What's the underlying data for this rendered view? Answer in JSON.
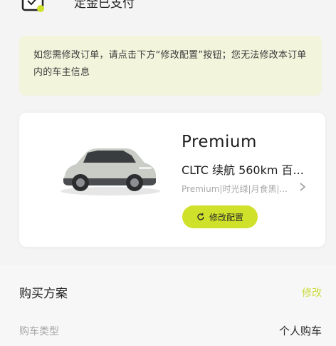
{
  "top": {
    "status_text": "定金已支付",
    "icon": "checkbox-check-icon"
  },
  "notice": {
    "text": "如您需修改订单，请点击下方“修改配置”按钮；您无法修改本订单内的车主信息"
  },
  "car": {
    "title": "Premium",
    "range_text": "CLTC 续航 560km 百...",
    "config_text": "Premium|时光绿|月食黑|...",
    "modify_button_label": "修改配置",
    "icons": [
      "car-image",
      "chevron-right-icon",
      "refresh-icon"
    ]
  },
  "plan": {
    "title": "购买方案",
    "edit_label": "修改",
    "purchase_type_label": "购车类型",
    "purchase_type_value": "个人购车"
  },
  "colors": {
    "accent": "#cfe12a",
    "accent_text": "#c9dc3a",
    "notice_bg": "#f3f4dc",
    "page_bg": "#f4f4f4"
  }
}
